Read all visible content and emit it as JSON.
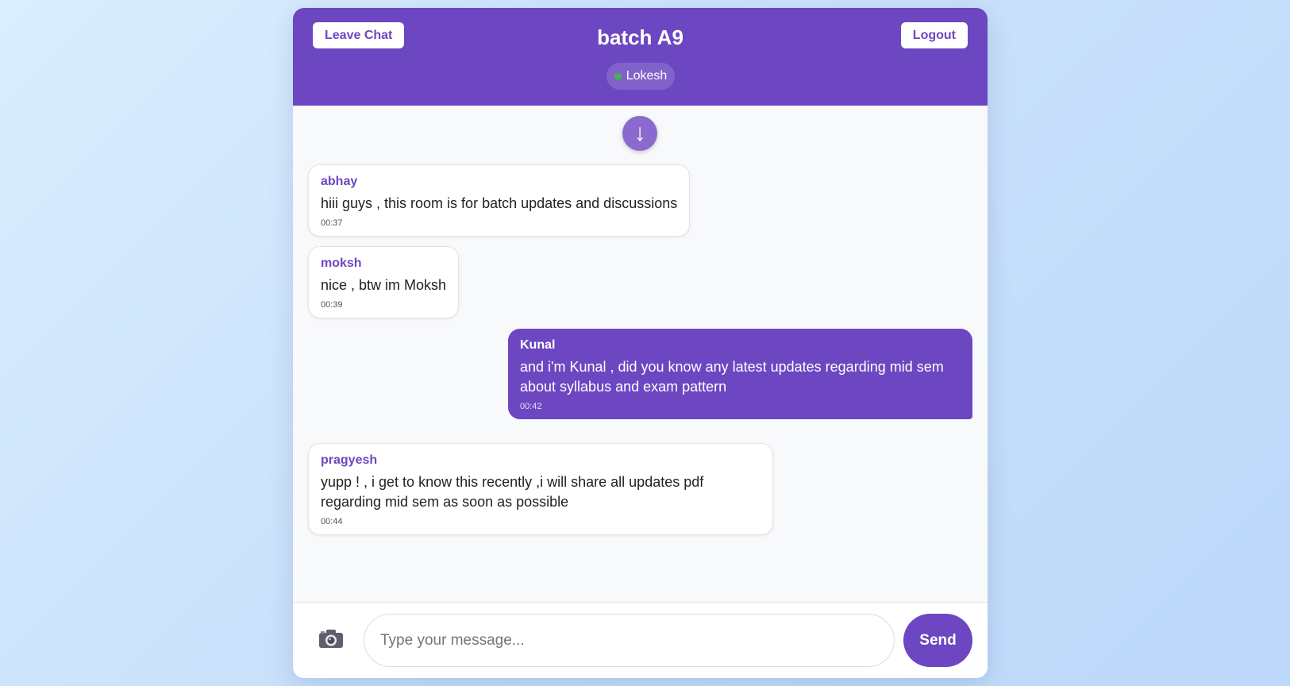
{
  "header": {
    "leave_label": "Leave Chat",
    "room_title": "batch A9",
    "logout_label": "Logout",
    "online_user": "Lokesh"
  },
  "scroll_down_icon": "↓",
  "messages": [
    {
      "author": "abhay",
      "text": "hiii guys , this room is for batch updates and discussions",
      "time": "00:37",
      "self": false
    },
    {
      "author": "moksh",
      "text": "nice , btw im Moksh",
      "time": "00:39",
      "self": false
    },
    {
      "author": "Kunal",
      "text": "and i'm Kunal , did you know any latest updates regarding mid sem about syllabus and exam pattern",
      "time": "00:42",
      "self": true
    },
    {
      "author": "pragyesh",
      "text": "yupp ! , i get to know this recently ,i will share all updates pdf regarding mid sem as soon as possible",
      "time": "00:44",
      "self": false
    }
  ],
  "composer": {
    "attach_icon": "camera-icon",
    "placeholder": "Type your message...",
    "value": "",
    "send_label": "Send"
  },
  "colors": {
    "accent": "#6c47c1",
    "online": "#4caf50",
    "background": "#c8e0fb"
  }
}
